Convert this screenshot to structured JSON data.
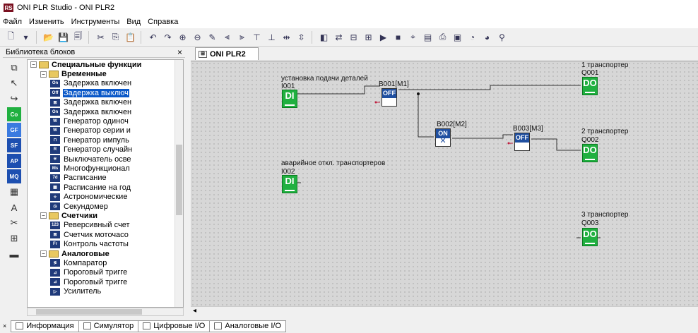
{
  "window": {
    "logo": "RS",
    "title": "ONI PLR Studio - ONI PLR2"
  },
  "menu": [
    "Файл",
    "Изменить",
    "Инструменты",
    "Вид",
    "Справка"
  ],
  "toolbar_icons": [
    "new-icon",
    "dropdown-icon",
    "open-icon",
    "save-icon",
    "save-all-icon",
    "cut-icon",
    "copy-icon",
    "paste-icon",
    "undo-icon",
    "redo-icon",
    "zoom-in-icon",
    "zoom-out-icon",
    "pen-icon",
    "align-left-icon",
    "align-right-icon",
    "align-top-icon",
    "align-bottom-icon",
    "distribute-h-icon",
    "distribute-v-icon",
    "compile-icon",
    "connect-icon",
    "download-icon",
    "monitor-icon",
    "run-icon",
    "stop-icon",
    "simulate-icon",
    "chart-icon",
    "print-icon",
    "print-preview-icon",
    "clock-icon",
    "time-icon",
    "search-icon"
  ],
  "library": {
    "header": "Библиотека блоков",
    "close": "×",
    "left_icons": [
      {
        "name": "block-icon",
        "label": "⧉",
        "style": "plain"
      },
      {
        "name": "pointer-icon",
        "label": "↖",
        "style": "plain"
      },
      {
        "name": "connector-icon",
        "label": "↪",
        "style": "plain"
      },
      {
        "name": "co-icon",
        "label": "Co",
        "style": "green"
      },
      {
        "name": "gf-icon",
        "label": "GF",
        "style": "blue"
      },
      {
        "name": "sf-icon",
        "label": "SF",
        "style": "navy"
      },
      {
        "name": "ap-icon",
        "label": "AP",
        "style": "navy"
      },
      {
        "name": "mq-icon",
        "label": "MQ",
        "style": "navy"
      },
      {
        "name": "table-icon",
        "label": "▦",
        "style": "plain"
      },
      {
        "name": "text-icon",
        "label": "A",
        "style": "plain"
      },
      {
        "name": "cut-wire-icon",
        "label": "✂",
        "style": "plain"
      },
      {
        "name": "network-icon",
        "label": "⊞",
        "style": "plain"
      },
      {
        "name": "module-icon",
        "label": "▬",
        "style": "plain"
      }
    ],
    "tree": [
      {
        "level": 0,
        "type": "folder",
        "label": "Специальные функции",
        "bold": true,
        "exp": "−"
      },
      {
        "level": 1,
        "type": "folder",
        "label": "Временные",
        "bold": true,
        "exp": "−"
      },
      {
        "level": 2,
        "type": "block",
        "icon": "On",
        "label": "Задержка включен"
      },
      {
        "level": 2,
        "type": "block",
        "icon": "Off",
        "label": "Задержка выключ",
        "selected": true
      },
      {
        "level": 2,
        "type": "block",
        "icon": "⊠",
        "label": "Задержка включен"
      },
      {
        "level": 2,
        "type": "block",
        "icon": "On",
        "label": "Задержка включен"
      },
      {
        "level": 2,
        "type": "block",
        "icon": "W",
        "label": "Генератор одиноч"
      },
      {
        "level": 2,
        "type": "block",
        "icon": "W",
        "label": "Генератор серии и"
      },
      {
        "level": 2,
        "type": "block",
        "icon": "⊓",
        "label": "Генератор импуль"
      },
      {
        "level": 2,
        "type": "block",
        "icon": "R",
        "label": "Генератор случайн"
      },
      {
        "level": 2,
        "type": "block",
        "icon": "☀",
        "label": "Выключатель осве"
      },
      {
        "level": 2,
        "type": "block",
        "icon": "Ms",
        "label": "Многофункционал"
      },
      {
        "level": 2,
        "type": "block",
        "icon": "7d",
        "label": "Расписание"
      },
      {
        "level": 2,
        "type": "block",
        "icon": "▦",
        "label": "Расписание на год"
      },
      {
        "level": 2,
        "type": "block",
        "icon": "✧",
        "label": "Астрономические"
      },
      {
        "level": 2,
        "type": "block",
        "icon": "◷",
        "label": "Секундомер"
      },
      {
        "level": 1,
        "type": "folder",
        "label": "Счетчики",
        "bold": true,
        "exp": "−"
      },
      {
        "level": 2,
        "type": "block",
        "icon": "123",
        "label": "Реверсивный счет"
      },
      {
        "level": 2,
        "type": "block",
        "icon": "⊠",
        "label": "Счетчик моточасо"
      },
      {
        "level": 2,
        "type": "block",
        "icon": "Fr",
        "label": "Контроль частоты"
      },
      {
        "level": 1,
        "type": "folder",
        "label": "Аналоговые",
        "bold": true,
        "exp": "−"
      },
      {
        "level": 2,
        "type": "block",
        "icon": "≶",
        "label": "Компаратор"
      },
      {
        "level": 2,
        "type": "block",
        "icon": "⊿",
        "label": "Пороговый тригге"
      },
      {
        "level": 2,
        "type": "block",
        "icon": "⊿",
        "label": "Пороговый тригге"
      },
      {
        "level": 2,
        "type": "block",
        "icon": "▷",
        "label": "Усилитель"
      }
    ]
  },
  "doc_tab": "ONI PLR2",
  "canvas": {
    "texts": {
      "label_i001": "установка подачи деталей",
      "label_i002": "аварийное откл. транспортеров",
      "label_q001": "1 транспортер",
      "label_q002": "2 транспортер",
      "label_q003": "3 транспортер",
      "id_i001": "I001",
      "id_i002": "I002",
      "id_b001": "B001[M1]",
      "id_b002": "B002[M2]",
      "id_b003": "B003[M3]",
      "id_q001": "Q001",
      "id_q002": "Q002",
      "id_q003": "Q003",
      "blk_di": "DI",
      "blk_do": "DO",
      "blk_off": "OFF",
      "blk_on": "ON",
      "blk_x": "✕"
    }
  },
  "bottom_tabs": {
    "close": "×",
    "items": [
      "Информация",
      "Симулятор",
      "Цифровые I/O",
      "Аналоговые I/O"
    ]
  }
}
